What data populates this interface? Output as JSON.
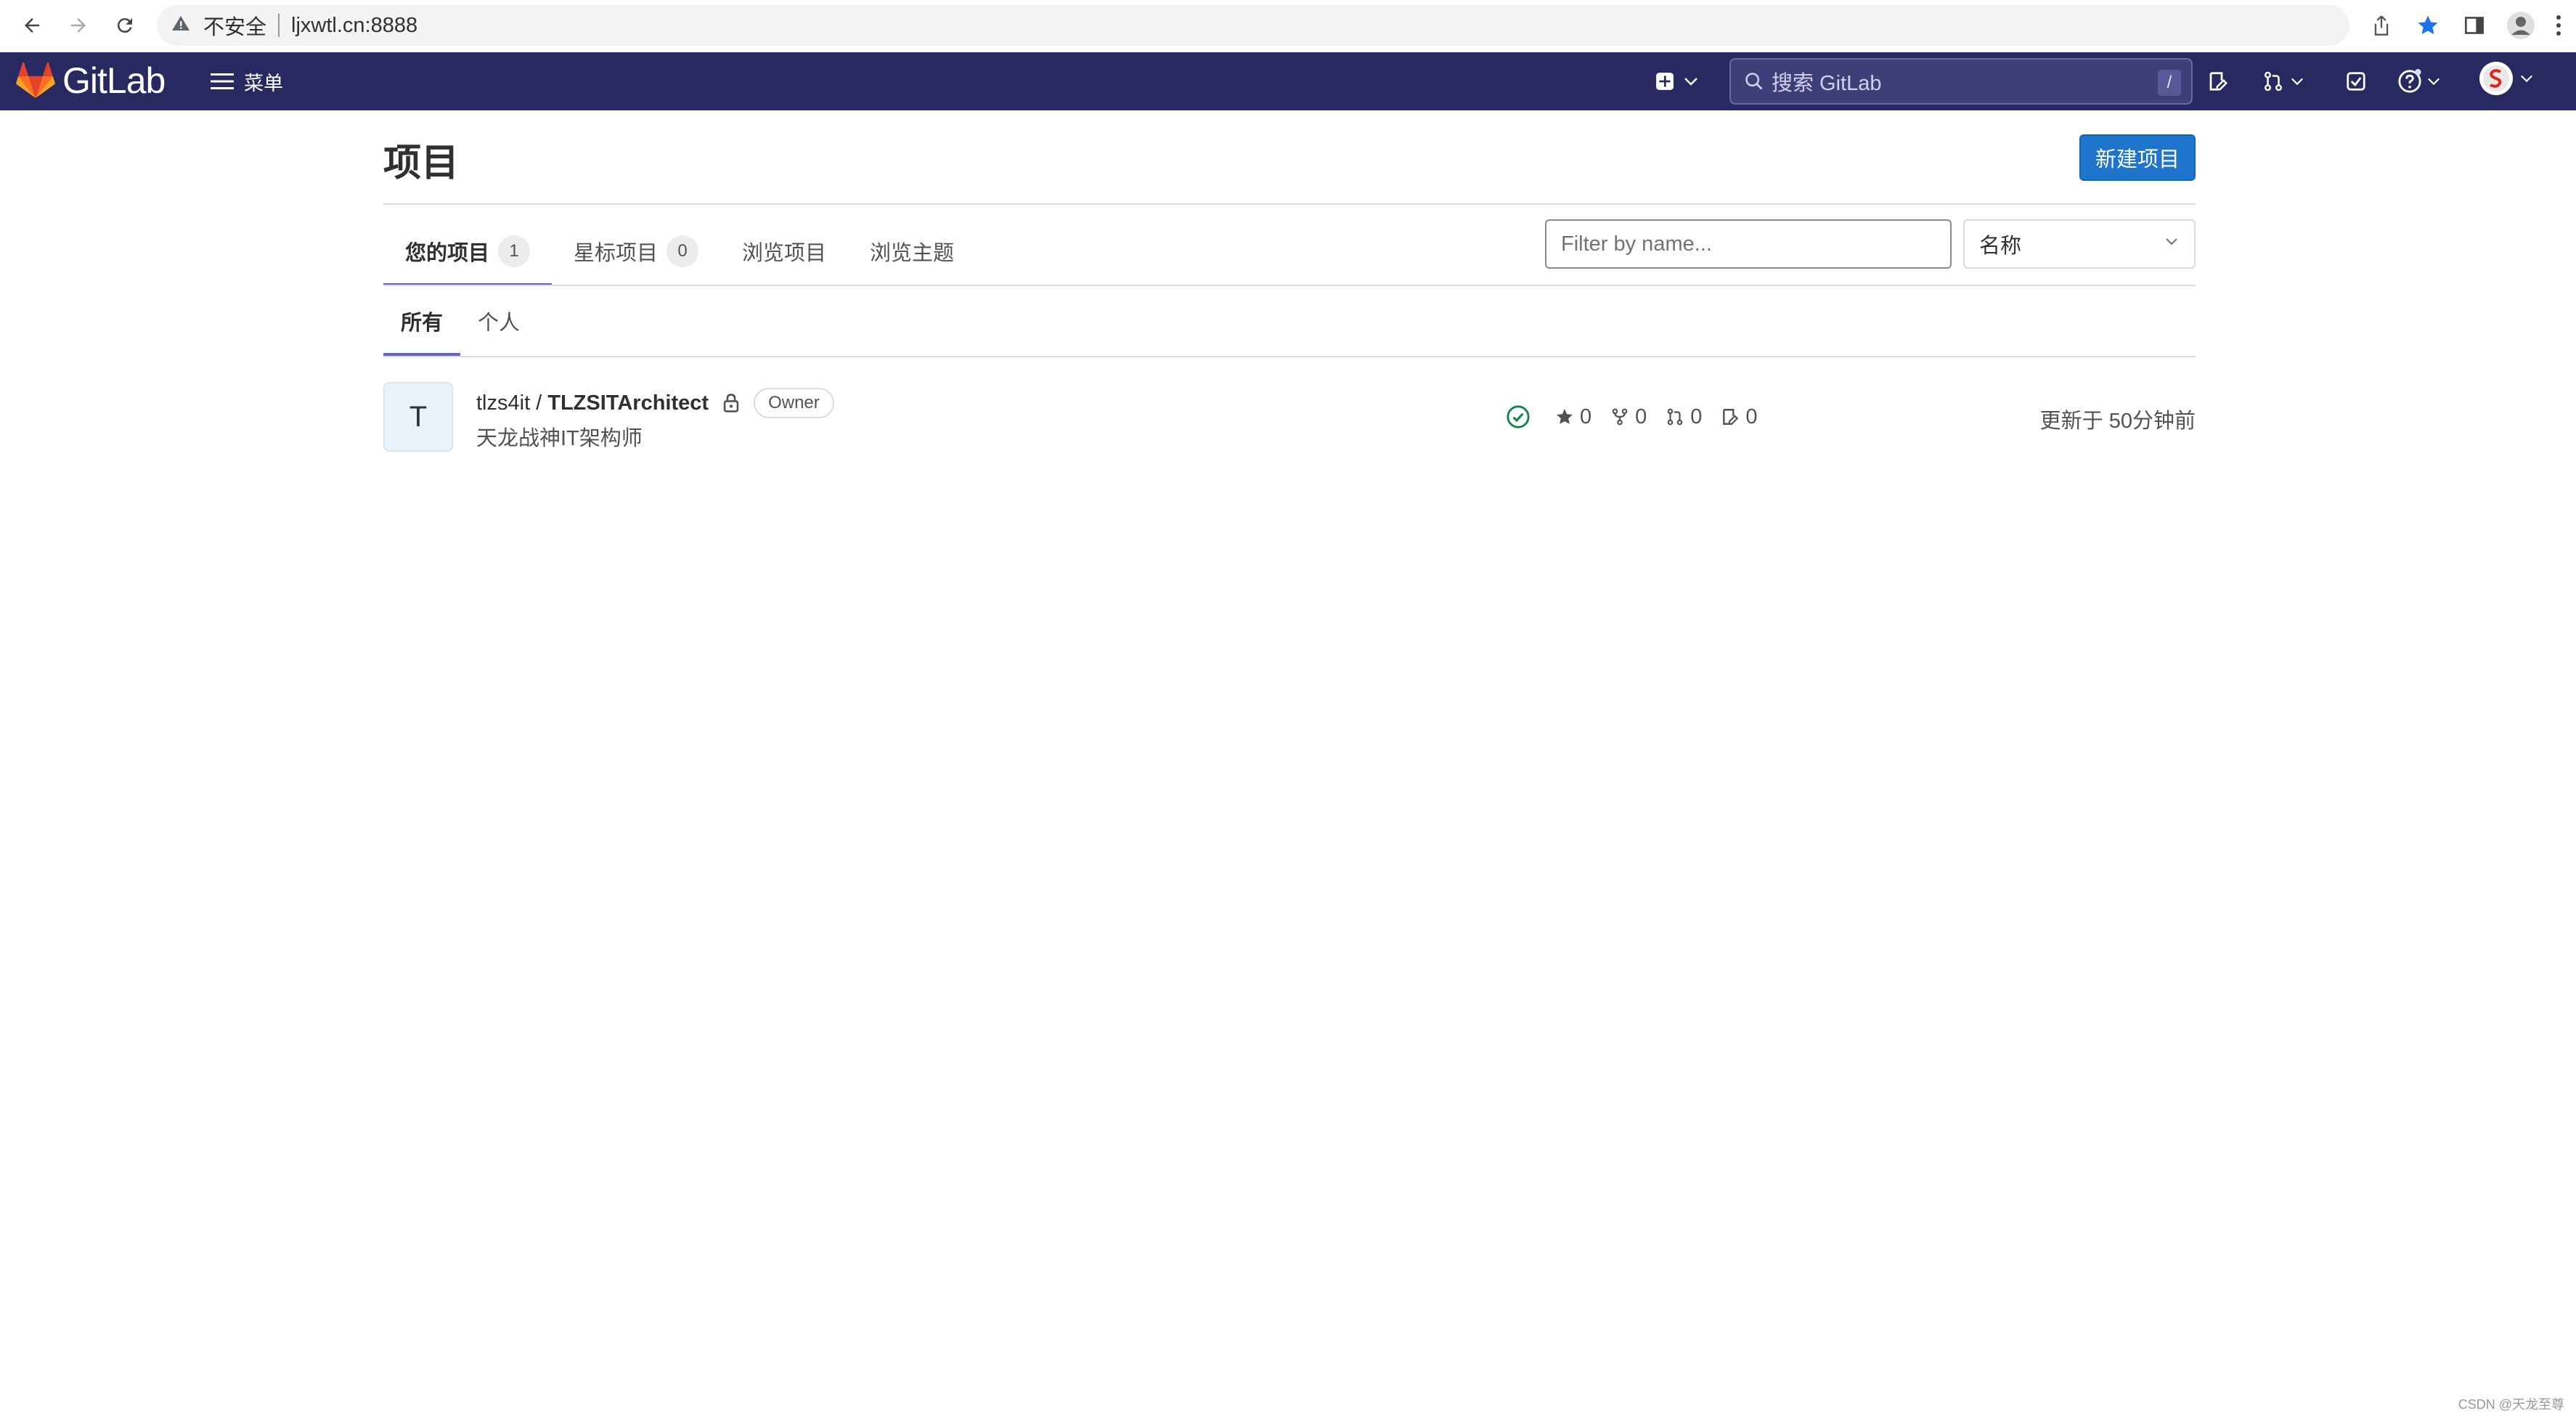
{
  "browser": {
    "insecure_label": "不安全",
    "url": "ljxwtl.cn:8888"
  },
  "topnav": {
    "logo_text": "GitLab",
    "menu_label": "菜单",
    "search_placeholder": "搜索 GitLab",
    "search_shortcut": "/"
  },
  "page": {
    "title": "项目",
    "new_project_button": "新建项目",
    "tabs": [
      {
        "label": "您的项目",
        "count": "1"
      },
      {
        "label": "星标项目",
        "count": "0"
      },
      {
        "label": "浏览项目"
      },
      {
        "label": "浏览主题"
      }
    ],
    "filter_placeholder": "Filter by name...",
    "sort_selected": "名称",
    "subtabs": [
      {
        "label": "所有"
      },
      {
        "label": "个人"
      }
    ]
  },
  "projects": [
    {
      "avatar_letter": "T",
      "namespace": "tlzs4it / ",
      "name": "TLZSITArchitect",
      "role": "Owner",
      "description": "天龙战神IT架构师",
      "stars": "0",
      "forks": "0",
      "merge_requests": "0",
      "issues": "0",
      "updated": "更新于 50分钟前"
    }
  ],
  "watermark": "CSDN @天龙至尊",
  "colors": {
    "nav_bg": "#292961",
    "primary": "#1f75cb",
    "tab_indicator": "#6666c4",
    "pipeline_success": "#108548"
  }
}
